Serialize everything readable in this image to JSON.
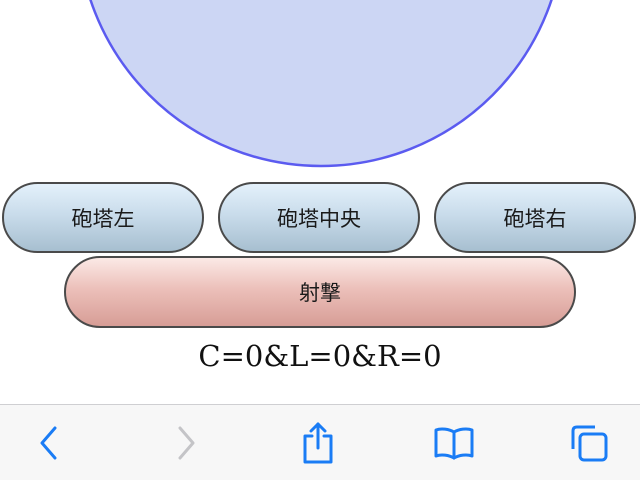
{
  "colors": {
    "radar_fill": "#ccd6f4",
    "radar_stroke": "#5b5bf0",
    "turret_button_gradient": [
      "#e4f1fb",
      "#a7bfd0"
    ],
    "fire_button_gradient": [
      "#fbe9e6",
      "#d79d96"
    ],
    "toolbar_icon_active": "#1a7cf5",
    "toolbar_icon_disabled": "#c4c4c7"
  },
  "buttons": {
    "turret_left": "砲塔左",
    "turret_center": "砲塔中央",
    "turret_right": "砲塔右",
    "fire": "射撃"
  },
  "status": {
    "text": "C=0&L=0&R=0"
  },
  "toolbar": {
    "icons": [
      {
        "name": "back-icon",
        "enabled": true
      },
      {
        "name": "forward-icon",
        "enabled": false
      },
      {
        "name": "share-icon",
        "enabled": true
      },
      {
        "name": "bookmarks-icon",
        "enabled": true
      },
      {
        "name": "tabs-icon",
        "enabled": true
      }
    ]
  }
}
